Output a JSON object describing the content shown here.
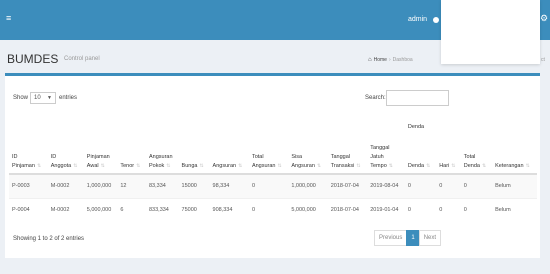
{
  "navbar": {
    "menu_icon": "≡",
    "user_name": "admin",
    "gear_icon": "⚙"
  },
  "header": {
    "title": "BUMDES",
    "subtitle": "Control panel",
    "breadcrumb": {
      "home_icon": "⌂",
      "home": "Home",
      "current": "Dashboa"
    },
    "edge_text": "ct"
  },
  "table_controls": {
    "show_label": "Show",
    "entries_value": "10",
    "entries_label": "entries",
    "search_label": "Search:",
    "search_placeholder": ""
  },
  "table": {
    "group_header": "Denda",
    "columns": [
      [
        "ID",
        "Pinjaman"
      ],
      [
        "ID",
        "Anggota"
      ],
      [
        "Pinjaman",
        "Awal"
      ],
      [
        "Tenor"
      ],
      [
        "Angsuran",
        "Pokok"
      ],
      [
        "Bunga"
      ],
      [
        "Angsuran"
      ],
      [
        "Total",
        "Angsuran"
      ],
      [
        "Sisa",
        "Angsuran"
      ],
      [
        "Tanggal",
        "Transaksi"
      ],
      [
        "Tanggal",
        "Jatuh",
        "Tempo"
      ],
      [
        "Denda"
      ],
      [
        "Hari"
      ],
      [
        "Total",
        "Denda"
      ],
      [
        "Keterangan"
      ]
    ],
    "rows": [
      [
        "P-0003",
        "M-0002",
        "1,000,000",
        "12",
        "83,334",
        "15000",
        "98,334",
        "0",
        "1,000,000",
        "2018-07-04",
        "2019-08-04",
        "0",
        "0",
        "0",
        "Belum"
      ],
      [
        "P-0004",
        "M-0002",
        "5,000,000",
        "6",
        "833,334",
        "75000",
        "908,334",
        "0",
        "5,000,000",
        "2018-07-04",
        "2019-01-04",
        "0",
        "0",
        "0",
        "Belum"
      ]
    ]
  },
  "footer": {
    "info": "Showing 1 to 2 of 2 entries",
    "pagination": {
      "previous": "Previous",
      "current": "1",
      "next": "Next"
    }
  },
  "colors": {
    "primary": "#3c8dbc",
    "background": "#ecf0f5"
  }
}
